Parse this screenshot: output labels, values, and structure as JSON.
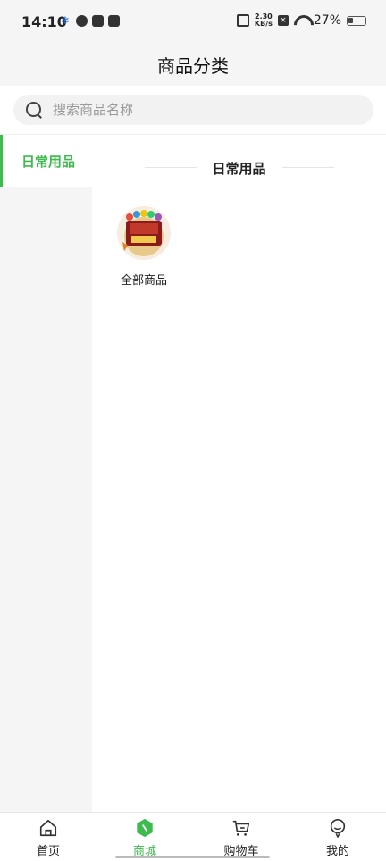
{
  "status_bar": {
    "time": "14:10",
    "net_speed_value": "2.30",
    "net_speed_unit": "KB/s",
    "battery_percent": "27%",
    "battery_level": 0.27
  },
  "header": {
    "title": "商品分类"
  },
  "search": {
    "placeholder": "搜索商品名称"
  },
  "sidebar": {
    "items": [
      {
        "label": "日常用品",
        "active": true
      }
    ]
  },
  "main": {
    "section_title": "日常用品",
    "categories": [
      {
        "label": "全部商品",
        "image_icon": "supermarket-promo-image"
      }
    ]
  },
  "tabbar": {
    "tabs": [
      {
        "label": "首页",
        "icon": "home-icon",
        "active": false
      },
      {
        "label": "商城",
        "icon": "shop-icon",
        "active": true
      },
      {
        "label": "购物车",
        "icon": "cart-icon",
        "active": false
      },
      {
        "label": "我的",
        "icon": "profile-icon",
        "active": false
      }
    ]
  },
  "colors": {
    "accent": "#3dbb4e",
    "background": "#f5f5f5"
  }
}
